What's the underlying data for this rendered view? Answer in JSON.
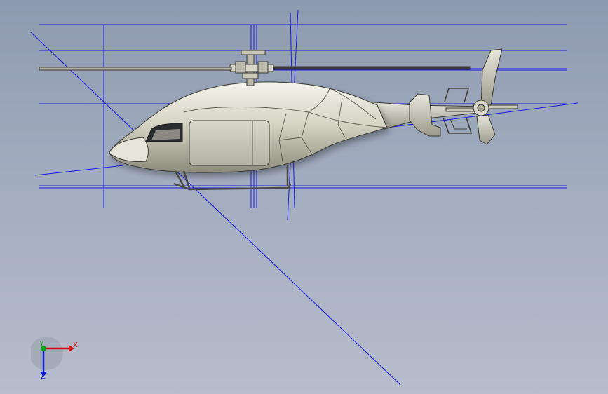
{
  "viewport": {
    "background_top": "#8e9aaf",
    "background_bottom": "#b6bdcc",
    "sketch_line_color": "#1a1adf",
    "model_body_color": "#d4d3c4"
  },
  "triad": {
    "x_label": "X",
    "y_label": "Y",
    "z_label": "Z",
    "x_color": "#d01010",
    "y_color": "#10a010",
    "z_color": "#1020d0"
  }
}
